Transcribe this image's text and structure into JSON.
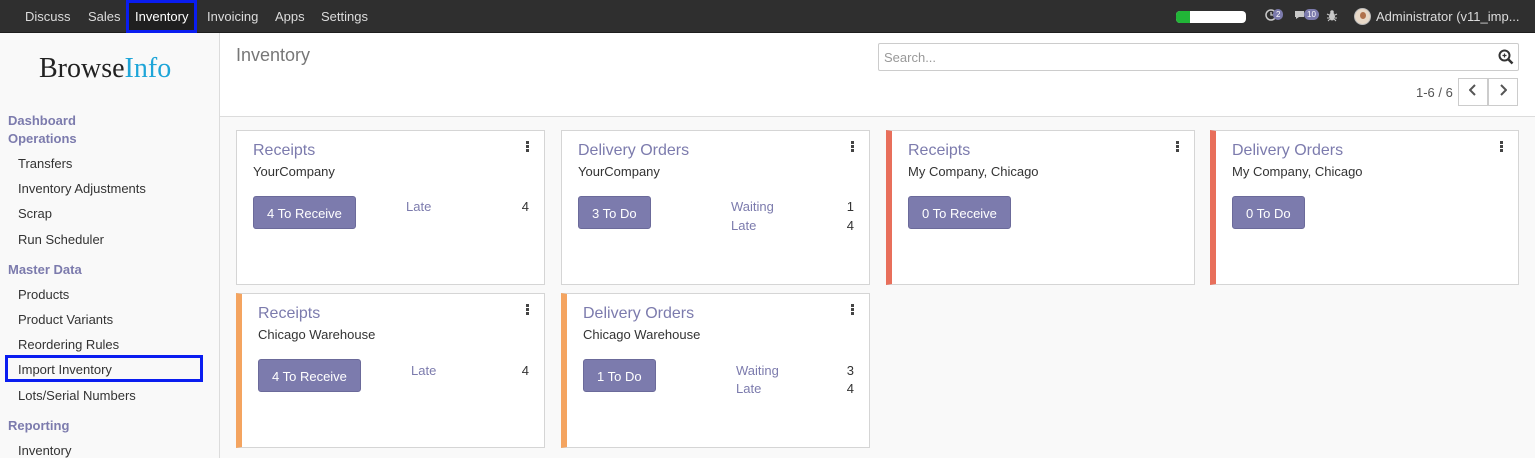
{
  "nav": {
    "menu": [
      "Discuss",
      "Sales",
      "Inventory",
      "Invoicing",
      "Apps",
      "Settings"
    ],
    "active": "Inventory",
    "progress_percent": 20,
    "progress_color": "#21b537",
    "activity_icon": "clock-icon",
    "activity_count": "2",
    "messages_icon": "chat-icon",
    "messages_count": "10",
    "debug_icon": "bug-icon",
    "user": "Administrator (v11_imp..."
  },
  "sidebar": {
    "logo_main": "Browse",
    "logo_accent": "Info",
    "sections": [
      {
        "heading": "Dashboard"
      },
      {
        "heading": "Operations",
        "items": [
          "Transfers",
          "Inventory Adjustments",
          "Scrap",
          "Run Scheduler"
        ]
      },
      {
        "heading": "Master Data",
        "items": [
          "Products",
          "Product Variants",
          "Reordering Rules",
          "Import Inventory",
          "Lots/Serial Numbers"
        ]
      },
      {
        "heading": "Reporting",
        "items": [
          "Inventory"
        ]
      }
    ]
  },
  "control": {
    "title": "Inventory",
    "search_placeholder": "Search...",
    "pager": "1-6 / 6"
  },
  "cards": [
    {
      "title": "Receipts",
      "company": "YourCompany",
      "button": "4 To Receive",
      "stats": [
        {
          "label": "Late",
          "value": "4"
        }
      ],
      "accent": "none"
    },
    {
      "title": "Delivery Orders",
      "company": "YourCompany",
      "button": "3 To Do",
      "stats": [
        {
          "label": "Waiting",
          "value": "1"
        },
        {
          "label": "Late",
          "value": "4"
        }
      ],
      "accent": "none"
    },
    {
      "title": "Receipts",
      "company": "My Company, Chicago",
      "button": "0 To Receive",
      "stats": [],
      "accent": "#e86f5b"
    },
    {
      "title": "Delivery Orders",
      "company": "My Company, Chicago",
      "button": "0 To Do",
      "stats": [],
      "accent": "#e86f5b"
    },
    {
      "title": "Receipts",
      "company": "Chicago Warehouse",
      "button": "4 To Receive",
      "stats": [
        {
          "label": "Late",
          "value": "4"
        }
      ],
      "accent": "#f4a460"
    },
    {
      "title": "Delivery Orders",
      "company": "Chicago Warehouse",
      "button": "1 To Do",
      "stats": [
        {
          "label": "Waiting",
          "value": "3"
        },
        {
          "label": "Late",
          "value": "4"
        }
      ],
      "accent": "#f4a460"
    }
  ]
}
